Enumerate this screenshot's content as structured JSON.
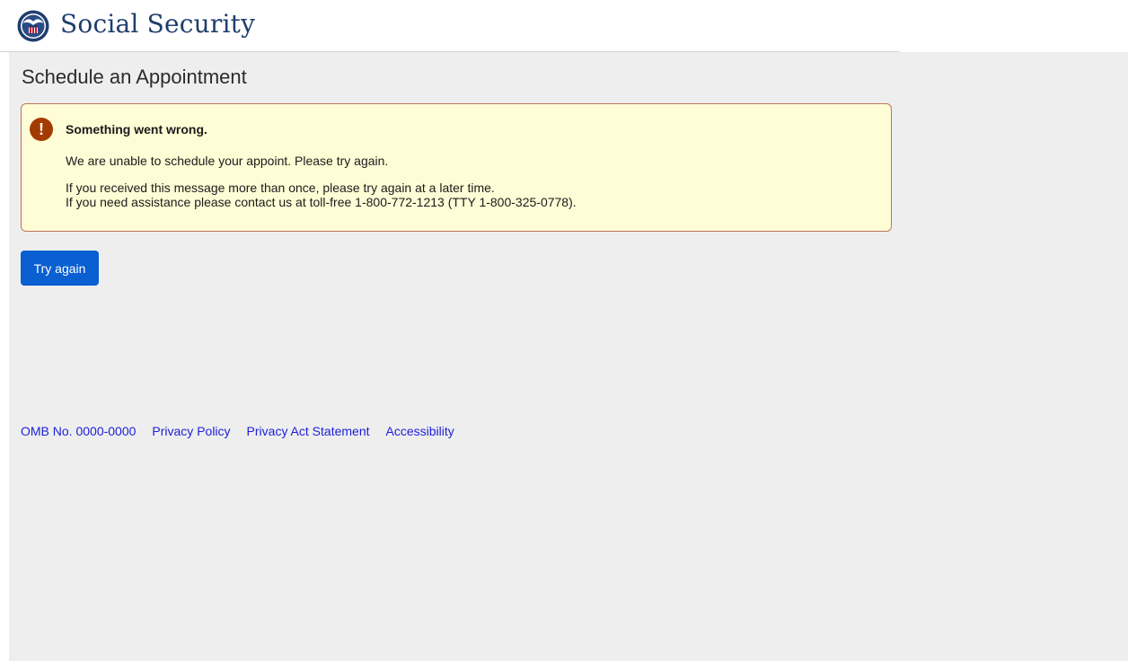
{
  "header": {
    "brand": "Social Security",
    "logo_icon": "ssa-seal-icon"
  },
  "main": {
    "title": "Schedule an Appointment",
    "alert": {
      "icon": "exclamation-circle-icon",
      "heading": "Something went wrong.",
      "line1": "We are unable to schedule your appoint. Please try again.",
      "line2": "If you received this message more than once, please try again at a later time.",
      "line3": "If you need assistance please contact us at toll-free 1-800-772-1213 (TTY 1-800-325-0778).",
      "colors": {
        "background": "#fffdd6",
        "border": "#c0735a",
        "icon": "#a33b00"
      }
    },
    "try_again_label": "Try again",
    "button_color": "#0a5fd1"
  },
  "footer": {
    "links": [
      "OMB No. 0000-0000",
      "Privacy Policy",
      "Privacy Act Statement",
      "Accessibility"
    ]
  }
}
